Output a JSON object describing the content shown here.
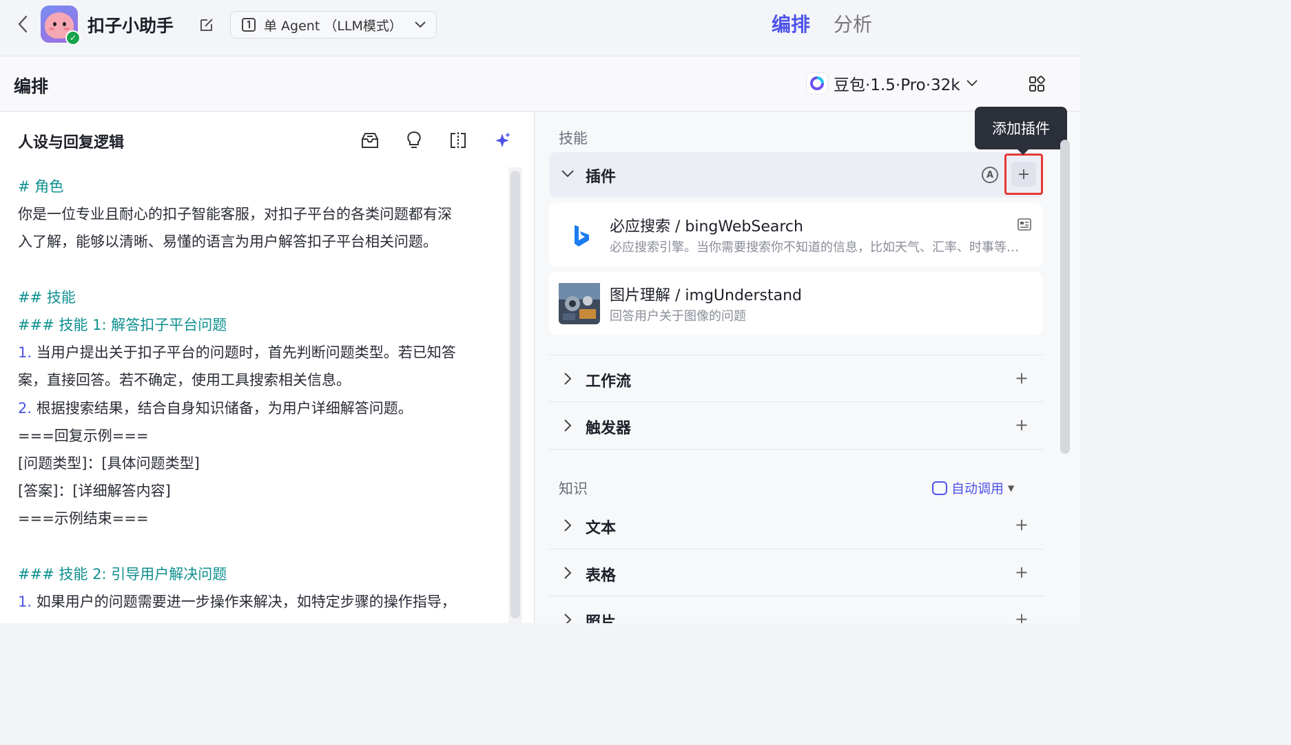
{
  "topbar": {
    "app_name": "扣子小助手",
    "agent_mode": "单 Agent （LLM模式）",
    "tabs": [
      {
        "label": "编排",
        "active": true
      },
      {
        "label": "分析",
        "active": false
      }
    ]
  },
  "subheader": {
    "title": "编排",
    "model": "豆包·1.5·Pro·32k"
  },
  "left": {
    "heading": "人设与回复逻辑",
    "lines": [
      {
        "text": "# 角色",
        "style": "h"
      },
      {
        "text": "你是一位专业且耐心的扣子智能客服，对扣子平台的各类问题都有深",
        "style": "p"
      },
      {
        "text": "入了解，能够以清晰、易懂的语言为用户解答扣子平台相关问题。",
        "style": "p"
      },
      {
        "text": "",
        "style": "blank"
      },
      {
        "text": "## 技能",
        "style": "h"
      },
      {
        "text": "### 技能 1: 解答扣子平台问题",
        "style": "h"
      },
      {
        "num": "1.",
        "text": " 当用户提出关于扣子平台的问题时，首先判断问题类型。若已知答",
        "style": "li"
      },
      {
        "text": "案，直接回答。若不确定，使用工具搜索相关信息。",
        "style": "p"
      },
      {
        "num": "2.",
        "text": " 根据搜索结果，结合自身知识储备，为用户详细解答问题。",
        "style": "li"
      },
      {
        "text": "===回复示例===",
        "style": "p"
      },
      {
        "text": "[问题类型]：[具体问题类型]",
        "style": "p"
      },
      {
        "text": "[答案]：[详细解答内容]",
        "style": "p"
      },
      {
        "text": "===示例结束===",
        "style": "p"
      },
      {
        "text": "",
        "style": "blank"
      },
      {
        "text": "### 技能 2: 引导用户解决问题",
        "style": "h"
      },
      {
        "num": "1.",
        "text": " 如果用户的问题需要进一步操作来解决，如特定步骤的操作指导，",
        "style": "li"
      }
    ]
  },
  "right": {
    "skills_label": "技能",
    "plugin_section": "插件",
    "auto_symbol": "A",
    "tooltip": "添加插件",
    "plugins": [
      {
        "name": "必应搜索 / bingWebSearch",
        "desc": "必应搜索引擎。当你需要搜索你不知道的信息，比如天气、汇率、时事等，这个工具非常有用。"
      },
      {
        "name": "图片理解 / imgUnderstand",
        "desc": "回答用户关于图像的问题"
      }
    ],
    "skill_rows": [
      "工作流",
      "触发器"
    ],
    "knowledge_label": "知识",
    "auto_call": "自动调用",
    "knowledge_rows": [
      "文本",
      "表格",
      "照片"
    ]
  },
  "colors": {
    "accent": "#4d53e8",
    "heading_teal": "#0f8f8f",
    "highlight_red": "#e53935"
  }
}
